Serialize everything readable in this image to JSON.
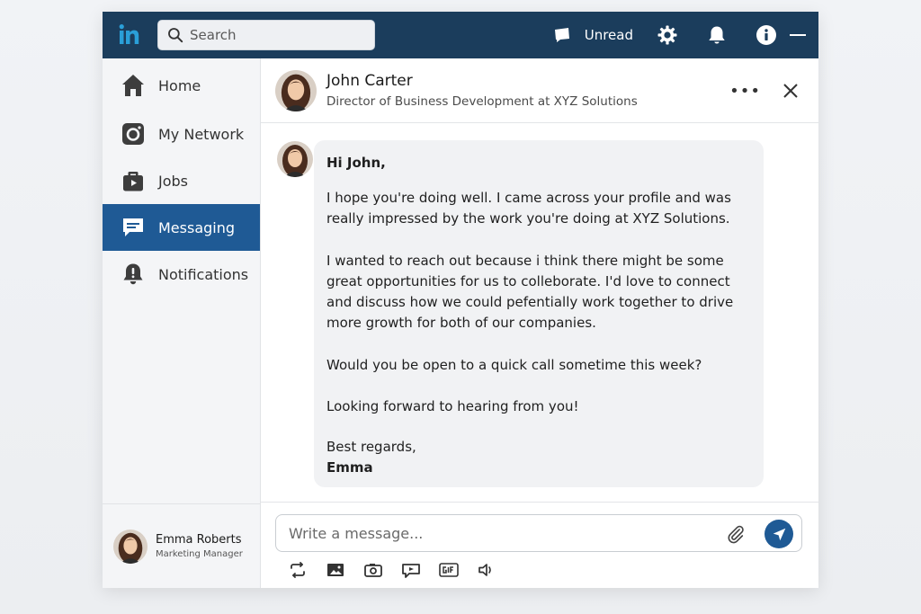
{
  "colors": {
    "topbar": "#1b3d5c",
    "accent": "#1f5a95",
    "sidebar_bg": "#f4f5f7",
    "bubble_bg": "#f1f2f4"
  },
  "topbar": {
    "logo_icon": "linkedin-logo-icon",
    "search": {
      "placeholder": "Search",
      "value": ""
    },
    "unread_label": "Unread",
    "icons": [
      "chat-icon",
      "gear-icon",
      "bell-icon",
      "info-icon",
      "minimize-icon"
    ]
  },
  "sidebar": {
    "items": [
      {
        "label": "Home",
        "icon": "home-icon",
        "active": false
      },
      {
        "label": "My Network",
        "icon": "network-icon",
        "active": false
      },
      {
        "label": "Jobs",
        "icon": "briefcase-icon",
        "active": false
      },
      {
        "label": "Messaging",
        "icon": "message-icon",
        "active": true
      },
      {
        "label": "Notifications",
        "icon": "alert-bell-icon",
        "active": false
      }
    ],
    "profile": {
      "name": "Emma Roberts",
      "title": "Marketing Manager"
    }
  },
  "conversation": {
    "contact": {
      "name": "John Carter",
      "title": "Director of Business Development at XYZ Solutions"
    },
    "more_label": "•••",
    "message": {
      "greeting": "Hi John,",
      "para1": "I hope you're doing well. I came across your profile and was really impressed by the work you're doing at XYZ Solutions.",
      "para2": "I wanted to reach out because i think there might be some great opportunities for us to colleborate. I'd love to connect and discuss how we could pefentially work together to drive more growth for both of our companies.",
      "para3": "Would you be open to a quick call sometime this week?",
      "para4": "Looking forward to hearing from you!",
      "signoff": "Best regards,",
      "signature": "Emma"
    },
    "composer": {
      "placeholder": "Write a message...",
      "value": "",
      "toolbar_icons": [
        "repost-icon",
        "image-icon",
        "camera-icon",
        "video-chat-icon",
        "gif-icon",
        "audio-icon"
      ]
    }
  }
}
